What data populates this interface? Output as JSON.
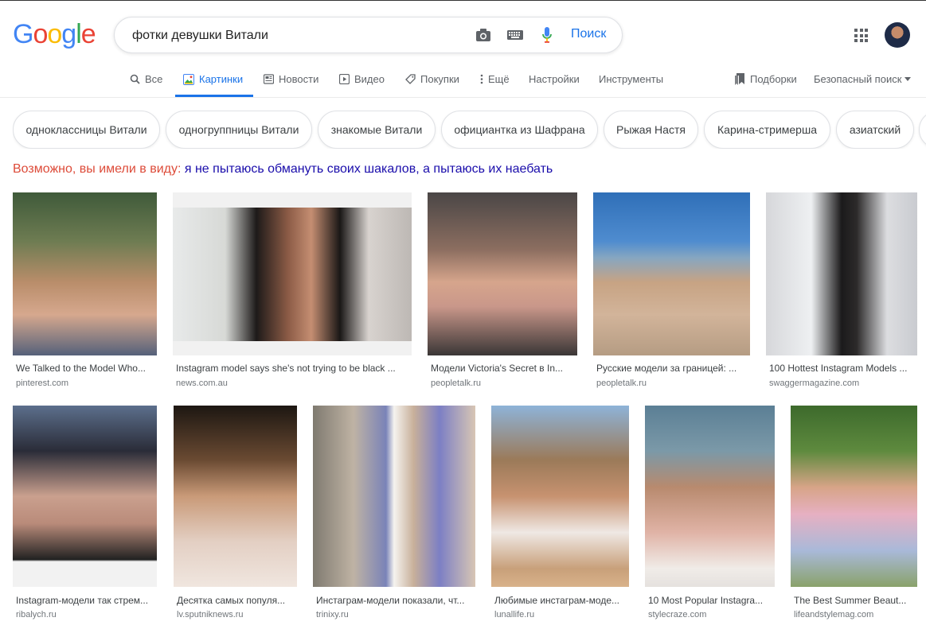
{
  "header": {
    "logo_letters": [
      "G",
      "o",
      "o",
      "g",
      "l",
      "e"
    ],
    "logo_colors": [
      "#4285f4",
      "#ea4335",
      "#fbbc05",
      "#4285f4",
      "#34a853",
      "#ea4335"
    ],
    "query": "фотки девушки Витали",
    "search_button": "Поиск"
  },
  "nav": {
    "all": "Все",
    "images": "Картинки",
    "news": "Новости",
    "video": "Видео",
    "shopping": "Покупки",
    "more": "Ещё",
    "settings": "Настройки",
    "tools": "Инструменты",
    "collections": "Подборки",
    "safe_search": "Безопасный поиск"
  },
  "chips": [
    "одноклассницы Витали",
    "одногруппницы Витали",
    "знакомые Витали",
    "официантка из Шафрана",
    "Рыжая Настя",
    "Карина-стримерша",
    "азиатский"
  ],
  "did_you_mean": {
    "label": "Возможно, вы имели в виду:",
    "suggestion": "я не пытаюсь обмануть своих шакалов, а пытаюсь их наебать"
  },
  "results": [
    {
      "caption": "We Talked to the Model Who...",
      "domain": "pinterest.com"
    },
    {
      "caption": "Instagram model says she's not trying to be black ...",
      "domain": "news.com.au"
    },
    {
      "caption": "Модели Victoria's Secret в In...",
      "domain": "peopletalk.ru"
    },
    {
      "caption": "Русские модели за границей: ...",
      "domain": "peopletalk.ru"
    },
    {
      "caption": "100 Hottest Instagram Models ...",
      "domain": "swaggermagazine.com"
    },
    {
      "caption": "Instagram-модели так стрем...",
      "domain": "ribalych.ru"
    },
    {
      "caption": "Десятка самых популя...",
      "domain": "lv.sputniknews.ru"
    },
    {
      "caption": "Инстаграм-модели показали, чт...",
      "domain": "trinixy.ru"
    },
    {
      "caption": "Любимые инстаграм-моде...",
      "domain": "lunallife.ru"
    },
    {
      "caption": "10 Most Popular Instagra...",
      "domain": "stylecraze.com"
    },
    {
      "caption": "The Best Summer Beaut...",
      "domain": "lifeandstylemag.com"
    }
  ]
}
